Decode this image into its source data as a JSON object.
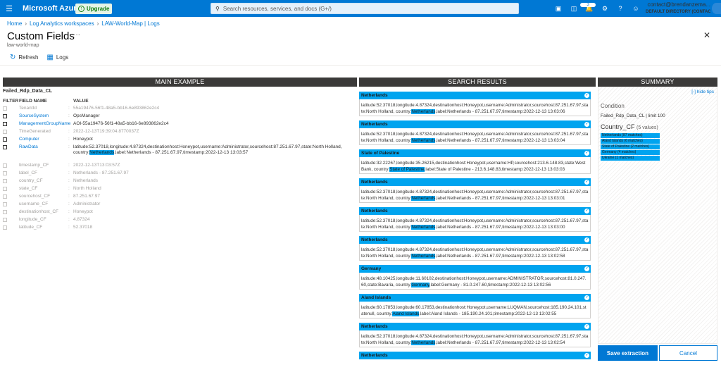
{
  "topbar": {
    "brand": "Microsoft Azure",
    "upgrade": "Upgrade",
    "search_placeholder": "Search resources, services, and docs (G+/)",
    "notification_count": "3",
    "account_email": "contact@brendanzema...",
    "account_directory": "DEFAULT DIRECTORY (CONTACTB..."
  },
  "breadcrumb": [
    "Home",
    "Log Analytics workspaces",
    "LAW-World-Map | Logs"
  ],
  "page": {
    "title": "Custom Fields",
    "subtitle": "law-world-map",
    "more": "···"
  },
  "commands": [
    {
      "label": "Refresh",
      "icon": "refresh-icon"
    },
    {
      "label": "Logs",
      "icon": "logs-icon"
    }
  ],
  "sections": {
    "main": "MAIN EXAMPLE",
    "results": "SEARCH RESULTS",
    "summary": "SUMMARY"
  },
  "main_example": {
    "table_name": "Failed_Rdp_Data_CL",
    "headers": {
      "filter": "FILTER",
      "field": "FIELD NAME",
      "value": "VALUE"
    },
    "rows": [
      {
        "field": "TenantId",
        "value": "55a19476-56f1-48a5-bb16-6e893862e2c4",
        "style": "muted"
      },
      {
        "field": "SourceSystem",
        "value": "OpsManager",
        "style": "link"
      },
      {
        "field": "ManagementGroupName",
        "value": "AOI-55a19476-56f1-48a5-bb16-6e893862e2c4",
        "style": "link"
      },
      {
        "field": "TimeGenerated",
        "value": "2022-12-13T19:39:04.8770037Z",
        "style": "muted"
      },
      {
        "field": "Computer",
        "value": "Honeypot",
        "style": "link"
      },
      {
        "field": "RawData",
        "value_pre": "latitude:52.37018,longitude:4.87324,destinationhost:Honeypot,username:Administrator,sourcehost:87.251.67.97,state:North Holland, country:",
        "value_hl": "Netherlands",
        "value_post": ",label:Netherlands - 87.251.67.97,timestamp:2022-12-13 13:03:57",
        "style": "link"
      },
      {
        "field": "timestamp_CF",
        "value": "2022-12-13T13:03:57Z",
        "style": "muted"
      },
      {
        "field": "label_CF",
        "value": "Netherlands - 87.251.67.97",
        "style": "muted"
      },
      {
        "field": "country_CF",
        "value": "Netherlands",
        "style": "muted"
      },
      {
        "field": "state_CF",
        "value": "North Holland",
        "style": "muted"
      },
      {
        "field": "sourcehost_CF",
        "value": "87.251.67.97",
        "style": "muted"
      },
      {
        "field": "username_CF",
        "value": "Administrator",
        "style": "muted"
      },
      {
        "field": "destinationhost_CF",
        "value": "Honeypot",
        "style": "muted"
      },
      {
        "field": "longitude_CF",
        "value": "4.87324",
        "style": "muted"
      },
      {
        "field": "latitude_CF",
        "value": "52.37018",
        "style": "muted"
      }
    ]
  },
  "results": [
    {
      "title": "Netherlands",
      "pre": "latitude:52.37018,longitude:4.87324,destinationhost:Honeypot,username:Administrator,sourcehost:87.251.67.97,state:North Holland, country:",
      "hl": "Netherlands",
      "post": ",label:Netherlands - 87.251.67.97,timestamp:2022-12-13 13:03:06"
    },
    {
      "title": "Netherlands",
      "pre": "latitude:52.37018,longitude:4.87324,destinationhost:Honeypot,username:Administrator,sourcehost:87.251.67.97,state:North Holland, country:",
      "hl": "Netherlands",
      "post": ",label:Netherlands - 87.251.67.97,timestamp:2022-12-13 13:03:04"
    },
    {
      "title": "State of Palestine",
      "pre": "latitude:32.22267,longitude:35.26215,destinationhost:Honeypot,username:HP,sourcehost:213.6.148.83,state:West Bank, country:",
      "hl": "State of Palestine",
      "post": ",label:State of Palestine - 213.6.148.83,timestamp:2022-12-13 13:03:03"
    },
    {
      "title": "Netherlands",
      "pre": "latitude:52.37018,longitude:4.87324,destinationhost:Honeypot,username:Administrator,sourcehost:87.251.67.97,state:North Holland, country:",
      "hl": "Netherlands",
      "post": ",label:Netherlands - 87.251.67.97,timestamp:2022-12-13 13:03:01"
    },
    {
      "title": "Netherlands",
      "pre": "latitude:52.37018,longitude:4.87324,destinationhost:Honeypot,username:Administrator,sourcehost:87.251.67.97,state:North Holland, country:",
      "hl": "Netherlands",
      "post": ",label:Netherlands - 87.251.67.97,timestamp:2022-12-13 13:03:00"
    },
    {
      "title": "Netherlands",
      "pre": "latitude:52.37018,longitude:4.87324,destinationhost:Honeypot,username:Administrator,sourcehost:87.251.67.97,state:North Holland, country:",
      "hl": "Netherlands",
      "post": ",label:Netherlands - 87.251.67.97,timestamp:2022-12-13 13:02:58"
    },
    {
      "title": "Germany",
      "pre": "latitude:48.10425,longitude:11.60102,destinationhost:Honeypot,username:ADMINISTRATOR,sourcehost:81.0.247.60,state:Bavaria, country:",
      "hl": "Germany",
      "post": ",label:Germany - 81.0.247.60,timestamp:2022-12-13 13:02:56"
    },
    {
      "title": "Aland Islands",
      "pre": "latitude:60.17853,longitude:60.17853,destinationhost:Honeypot,username:LUQMAN,sourcehost:185.190.24.101,statenull, country:",
      "hl": "Aland Islands",
      "post": ",label:Aland Islands - 185.190.24.101,timestamp:2022-12-13 13:02:55"
    },
    {
      "title": "Netherlands",
      "pre": "latitude:52.37018,longitude:4.87324,destinationhost:Honeypot,username:Administrator,sourcehost:87.251.67.97,state:North Holland, country:",
      "hl": "Netherlands",
      "post": ",label:Netherlands - 87.251.67.97,timestamp:2022-12-13 13:02:54"
    },
    {
      "title": "Netherlands",
      "pre": "",
      "hl": "",
      "post": ""
    }
  ],
  "summary": {
    "hide_tips": "[-] hide tips",
    "condition_label": "Condition",
    "condition_value": "Failed_Rdp_Data_CL | limit 100",
    "field": "Country_CF",
    "field_count": "(5 values)",
    "bars": [
      {
        "label": "Netherlands (87 matches)",
        "fraction": 1.0
      },
      {
        "label": "Aland Islands (6 matches)",
        "fraction": 1.0
      },
      {
        "label": "State of Palestine (2 matches)",
        "fraction": 1.0
      },
      {
        "label": "Germany (4 matches)",
        "fraction": 1.0
      },
      {
        "label": "Ukraine (1 matches)",
        "fraction": 1.0
      }
    ]
  },
  "buttons": {
    "save": "Save extraction",
    "cancel": "Cancel"
  }
}
